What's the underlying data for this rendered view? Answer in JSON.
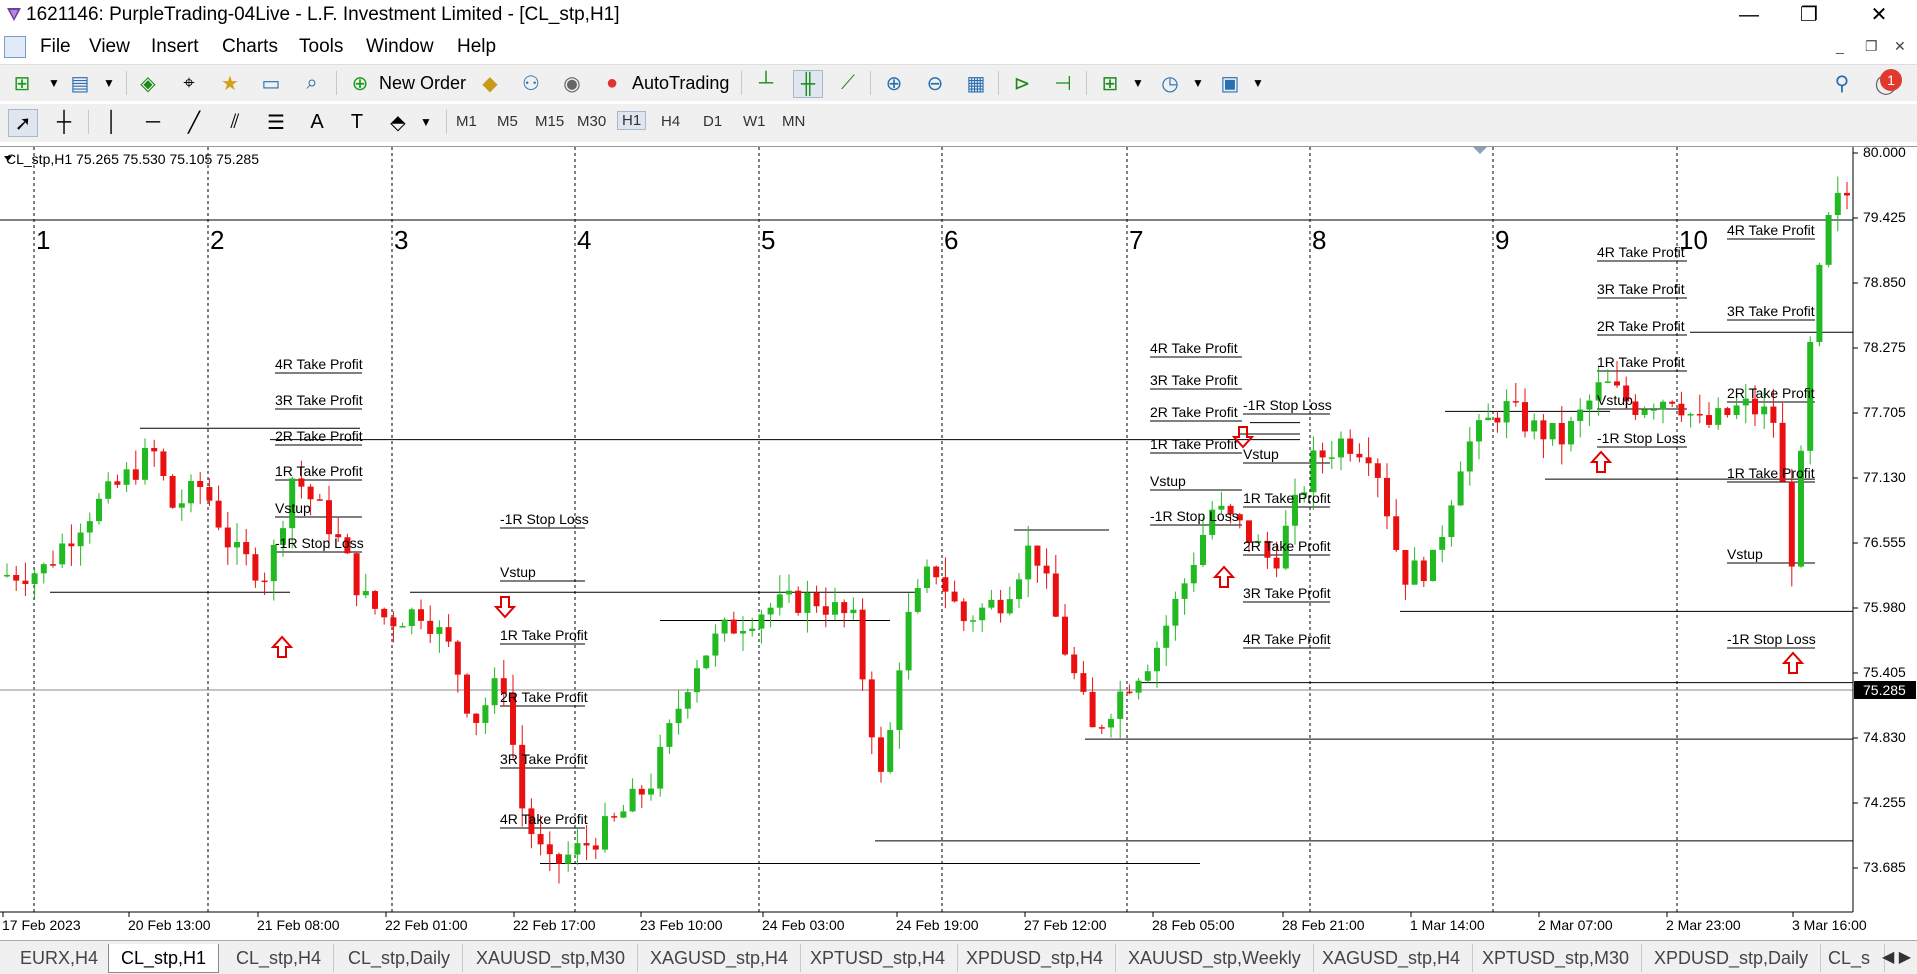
{
  "window": {
    "title": "1621146: PurpleTrading-04Live - L.F. Investment Limited - [CL_stp,H1]",
    "minimize": "—",
    "maximize": "❐",
    "close": "✕"
  },
  "menu": {
    "items": [
      "File",
      "View",
      "Insert",
      "Charts",
      "Tools",
      "Window",
      "Help"
    ],
    "mdi_minimize": "_",
    "mdi_restore": "❐",
    "mdi_close": "✕"
  },
  "toolbar": {
    "new_order_label": "New Order",
    "autotrading_label": "AutoTrading",
    "notification_count": "1"
  },
  "timeframes": [
    "M1",
    "M5",
    "M15",
    "M30",
    "H1",
    "H4",
    "D1",
    "W1",
    "MN"
  ],
  "active_timeframe": "H1",
  "chart": {
    "header": "CL_stp,H1  75.265 75.530 75.105 75.285",
    "current_price": "75.285",
    "price_labels": [
      "80.000",
      "79.425",
      "78.850",
      "78.275",
      "77.705",
      "77.130",
      "76.555",
      "75.980",
      "75.405",
      "74.830",
      "74.255",
      "73.685"
    ],
    "time_labels": [
      "17 Feb 2023",
      "20 Feb 13:00",
      "21 Feb 08:00",
      "22 Feb 01:00",
      "22 Feb 17:00",
      "23 Feb 10:00",
      "24 Feb 03:00",
      "24 Feb 19:00",
      "27 Feb 12:00",
      "28 Feb 05:00",
      "28 Feb 21:00",
      "1 Mar 14:00",
      "2 Mar 07:00",
      "2 Mar 23:00",
      "3 Mar 16:00"
    ],
    "section_numbers": [
      "1",
      "2",
      "3",
      "4",
      "5",
      "6",
      "7",
      "8",
      "9",
      "10"
    ],
    "trade_labels": {
      "t1": [
        "4R Take Profit",
        "3R Take Profit",
        "2R Take Profit",
        "1R Take Profit",
        "Vstup",
        "-1R Stop Loss"
      ],
      "t2": [
        "-1R Stop Loss",
        "Vstup",
        "1R Take Profit",
        "2R Take Profit",
        "3R Take Profit",
        "4R Take Profit"
      ],
      "t3": [
        "4R Take Profit",
        "3R Take Profit",
        "2R Take Profit",
        "1R Take Profit",
        "Vstup",
        "-1R Stop Loss"
      ],
      "t4": [
        "-1R Stop Loss",
        "Vstup",
        "1R Take Profit",
        "2R Take Profit",
        "3R Take Profit",
        "4R Take Profit"
      ],
      "t5": [
        "4R Take Profit",
        "3R Take Profit",
        "2R Take Profit",
        "1R Take Profit",
        "Vstup",
        "-1R Stop Loss"
      ],
      "t6": [
        "4R Take Profit",
        "3R Take Profit",
        "2R Take Profit",
        "1R Take Profit",
        "Vstup",
        "-1R Stop Loss"
      ]
    },
    "colors": {
      "bull": "#22b922",
      "bear": "#e81010",
      "arrow": "#e00000",
      "grid": "#000000"
    }
  },
  "tabs": [
    "EURX,H4",
    "CL_stp,H1",
    "CL_stp,H4",
    "CL_stp,Daily",
    "XAUUSD_stp,M30",
    "XAGUSD_stp,H4",
    "XPTUSD_stp,H4",
    "XPDUSD_stp,H4",
    "XAUUSD_stp,Weekly",
    "XAGUSD_stp,H4",
    "XPTUSD_stp,M30",
    "XPDUSD_stp,Daily",
    "CL_s"
  ],
  "active_tab": "CL_stp,H1"
}
